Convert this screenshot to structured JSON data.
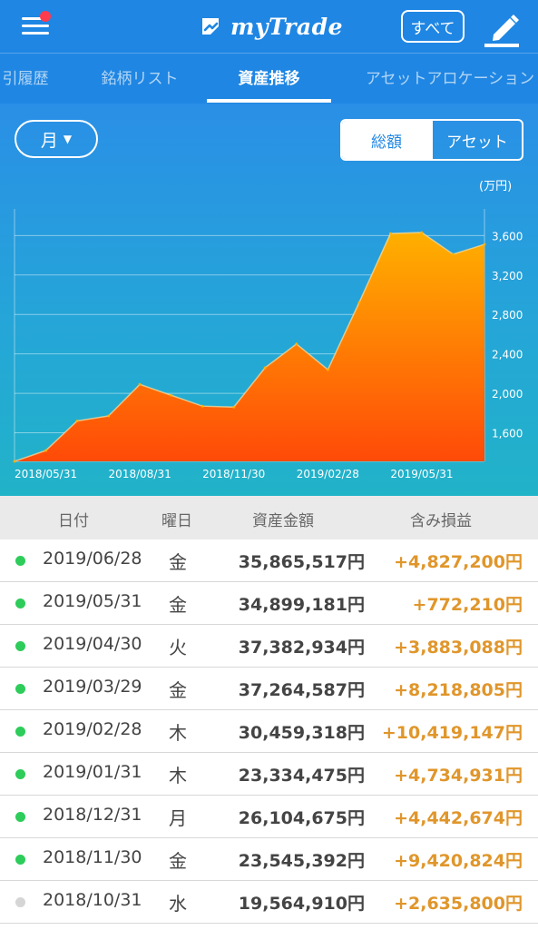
{
  "header": {
    "logo_text": "myTrade",
    "filter_label": "すべて",
    "colors": {
      "bar": "#1f86e3",
      "notification_dot": "#ff3b4e"
    }
  },
  "tabs": [
    {
      "label": "引履歴",
      "active": false
    },
    {
      "label": "銘柄リスト",
      "active": false
    },
    {
      "label": "資産推移",
      "active": true
    },
    {
      "label": "アセットアロケーション",
      "active": false
    }
  ],
  "controls": {
    "period_label": "月",
    "segment": [
      {
        "label": "総額",
        "selected": true
      },
      {
        "label": "アセット",
        "selected": false
      }
    ]
  },
  "chart_data": {
    "type": "area",
    "unit_label": "(万円)",
    "y_ticks": [
      1600,
      2000,
      2400,
      2800,
      3200,
      3600
    ],
    "y_tick_labels": [
      "1,600",
      "2,000",
      "2,400",
      "2,800",
      "3,200",
      "3,600"
    ],
    "ylim": [
      1310,
      3870
    ],
    "x_tick_labels": [
      "2018/05/31",
      "2018/08/31",
      "2018/11/30",
      "2019/02/28",
      "2019/05/31"
    ],
    "x_tick_indices": [
      1,
      4,
      7,
      10,
      13
    ],
    "x": [
      "2018/04",
      "2018/05",
      "2018/06",
      "2018/07",
      "2018/08",
      "2018/09",
      "2018/10",
      "2018/11",
      "2018/12",
      "2019/01",
      "2019/02",
      "2019/03",
      "2019/04",
      "2019/05",
      "2019/06"
    ],
    "values": [
      1310,
      1420,
      1720,
      1770,
      2090,
      1980,
      1870,
      1860,
      2260,
      2500,
      2240,
      2920,
      3620,
      3630,
      3410
    ],
    "last_value": 3510,
    "grid": true,
    "colors": {
      "fill_top": "#ffb000",
      "fill_bottom": "#ff4a08",
      "stroke": "#ffe0a0",
      "grid": "rgba(255,255,255,0.45)"
    }
  },
  "table": {
    "headers": [
      "日付",
      "曜日",
      "資産金額",
      "含み損益"
    ],
    "rows": [
      {
        "date": "2019/06/28",
        "day": "金",
        "amount": "35,865,517円",
        "pnl": "+4,827,200円",
        "dot": "#2ecc5a"
      },
      {
        "date": "2019/05/31",
        "day": "金",
        "amount": "34,899,181円",
        "pnl": "+772,210円",
        "dot": "#2ecc5a"
      },
      {
        "date": "2019/04/30",
        "day": "火",
        "amount": "37,382,934円",
        "pnl": "+3,883,088円",
        "dot": "#2ecc5a"
      },
      {
        "date": "2019/03/29",
        "day": "金",
        "amount": "37,264,587円",
        "pnl": "+8,218,805円",
        "dot": "#2ecc5a"
      },
      {
        "date": "2019/02/28",
        "day": "木",
        "amount": "30,459,318円",
        "pnl": "+10,419,147円",
        "dot": "#2ecc5a"
      },
      {
        "date": "2019/01/31",
        "day": "木",
        "amount": "23,334,475円",
        "pnl": "+4,734,931円",
        "dot": "#2ecc5a"
      },
      {
        "date": "2018/12/31",
        "day": "月",
        "amount": "26,104,675円",
        "pnl": "+4,442,674円",
        "dot": "#2ecc5a"
      },
      {
        "date": "2018/11/30",
        "day": "金",
        "amount": "23,545,392円",
        "pnl": "+9,420,824円",
        "dot": "#2ecc5a"
      },
      {
        "date": "2018/10/31",
        "day": "水",
        "amount": "19,564,910円",
        "pnl": "+2,635,800円",
        "dot": "#d5d5d5"
      }
    ]
  }
}
